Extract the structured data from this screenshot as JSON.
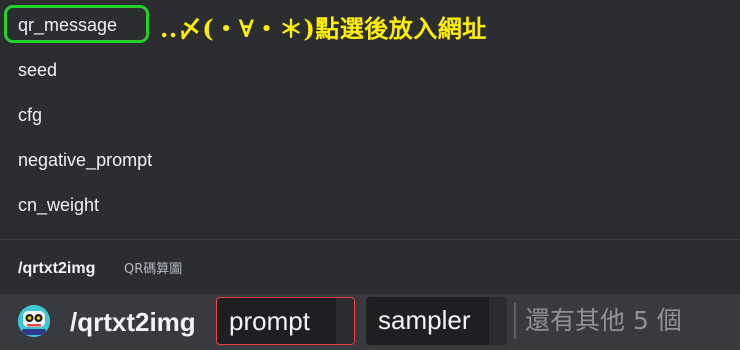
{
  "options": [
    "qr_message",
    "seed",
    "cfg",
    "negative_prompt",
    "cn_weight"
  ],
  "annotation": "..〆(・∀・＊)點選後放入網址",
  "command_header": {
    "name": "/qrtxt2img",
    "description": "QR碼算圖"
  },
  "composer": {
    "avatar_icon": "bot-avatar-icon",
    "command": "/qrtxt2img",
    "chips": [
      "prompt",
      "sampler"
    ],
    "more_text": "還有其他 5 個"
  },
  "colors": {
    "background": "#2b2d31",
    "composer": "#383a40",
    "highlight": "#22d22b",
    "annotation": "#ffee00",
    "required_border": "#f23f42"
  }
}
